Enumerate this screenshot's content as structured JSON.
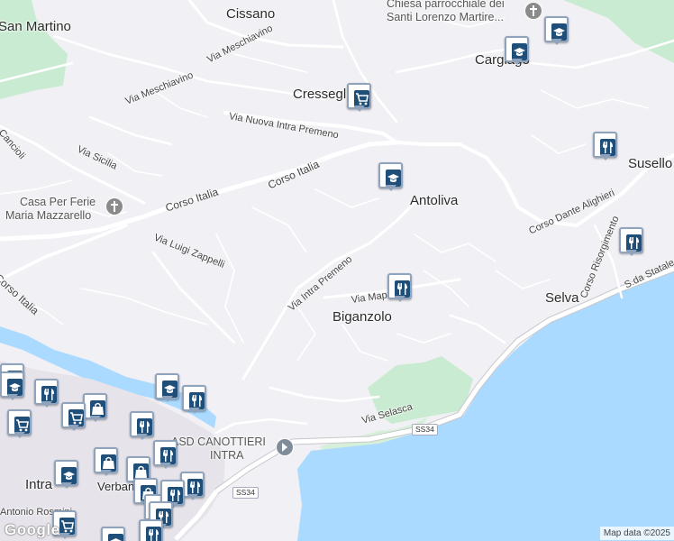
{
  "map": {
    "places": {
      "cissano": "Cissano",
      "san_martino": "San Martino",
      "cresseglio": "Cresseglio",
      "cargiago": "Cargiago",
      "antoliva": "Antoliva",
      "susello": "Susello",
      "biganzolo": "Biganzolo",
      "selva": "Selva",
      "intra": "Intra",
      "verbania": "Verbania"
    },
    "pois": {
      "church_lines": [
        "Chiesa parrocchiale dei",
        "Santi Lorenzo Martire..."
      ],
      "casa_lines": [
        "Casa Per Ferie",
        "Maria Mazzarello"
      ],
      "asd_lines": [
        "ASD CANOTTIERI",
        "INTRA"
      ]
    },
    "streets": {
      "meschiavino1": "Via Meschiavino",
      "meschiavino2": "Via Meschiavino",
      "nuova_intra": "Via Nuova Intra Premeno",
      "sicilia": "Via Sicilia",
      "italia1": "Corso Italia",
      "italia2": "Corso Italia",
      "italia3": "Corso Italia",
      "zappelli": "Via Luigi Zappelli",
      "intra_premeno": "Via Intra Premeno",
      "via_map": "Via Map",
      "selasca": "Via Selasca",
      "dante": "Corso Dante Alighieri",
      "risorgimento": "Corso Risorgimento",
      "statale": "S.da Statale",
      "rosmini": "Antonio Rosmini",
      "cancioli": "Cancioli"
    },
    "shields": {
      "ss34a": "SS34",
      "ss34b": "SS34"
    },
    "google": "Google",
    "attribution": "Map data ©2025",
    "colors": {
      "water": "#aadaff",
      "land": "#f1f0f4",
      "park": "#c9ebd2",
      "road": "#ffffff",
      "pin_fill": "#1f4e79",
      "pin_border": "#8fa3bd"
    }
  },
  "pins": [
    {
      "type": "school-icon"
    },
    {
      "type": "school-icon"
    },
    {
      "type": "shopping-cart-icon"
    },
    {
      "type": "school-icon"
    },
    {
      "type": "restaurant-icon"
    },
    {
      "type": "restaurant-icon"
    },
    {
      "type": "restaurant-icon"
    },
    {
      "type": "school-icon"
    },
    {
      "type": "restaurant-icon"
    },
    {
      "type": "restaurant-icon"
    },
    {
      "type": "shopping-bag-icon"
    },
    {
      "type": "shopping-cart-icon"
    },
    {
      "type": "restaurant-icon"
    },
    {
      "type": "shopping-cart-icon"
    },
    {
      "type": "restaurant-icon"
    },
    {
      "type": "school-icon"
    },
    {
      "type": "shopping-bag-icon"
    },
    {
      "type": "shopping-bag-icon"
    },
    {
      "type": "restaurant-icon"
    },
    {
      "type": "school-icon"
    },
    {
      "type": "restaurant-icon"
    },
    {
      "type": "shopping-bag-icon"
    },
    {
      "type": "restaurant-icon"
    },
    {
      "type": "restaurant-icon"
    },
    {
      "type": "restaurant-icon"
    },
    {
      "type": "shopping-cart-icon"
    },
    {
      "type": "school-icon"
    },
    {
      "type": "restaurant-icon"
    }
  ]
}
